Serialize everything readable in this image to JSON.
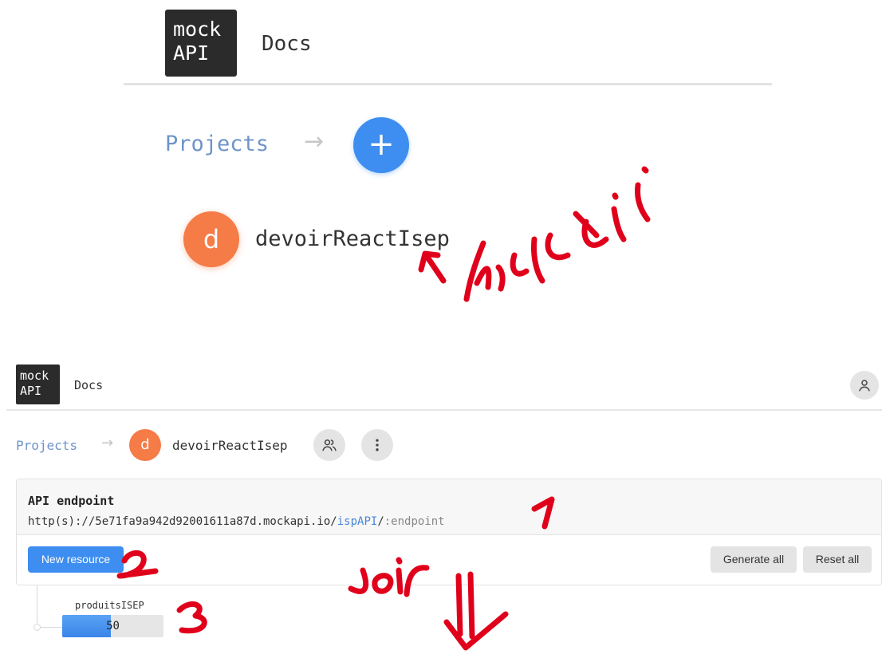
{
  "zoomed_header": {
    "logo_line1": "mock",
    "logo_line2": "API",
    "docs_label": "Docs"
  },
  "zoomed_projects": {
    "projects_label": "Projects",
    "add_button_label": "+",
    "project_initial": "d",
    "project_name": "devoirReactIsep"
  },
  "header": {
    "logo_line1": "mock",
    "logo_line2": "API",
    "docs_label": "Docs",
    "user_icon": "user-icon"
  },
  "breadcrumb": {
    "projects_label": "Projects",
    "separator_icon": "arrow-right-icon",
    "project_initial": "d",
    "project_name": "devoirReactIsep",
    "members_icon": "users-icon",
    "more_icon": "more-vertical-icon"
  },
  "endpoint": {
    "title": "API endpoint",
    "url_prefix": "http(s)://5e71fa9a942d92001611a87d.mockapi.io/",
    "url_namespace": "ispAPI",
    "url_slash": "/",
    "url_placeholder": ":endpoint"
  },
  "actions": {
    "new_resource": "New resource",
    "generate_all": "Generate all",
    "reset_all": "Reset all"
  },
  "resources": [
    {
      "name": "produitsISEP",
      "count": "50",
      "fill_fraction": 0.48
    }
  ],
  "colors": {
    "primary": "#3d8ef0",
    "avatar": "#f57b47",
    "link": "#6f93c9",
    "annotation": "#e0001b"
  }
}
